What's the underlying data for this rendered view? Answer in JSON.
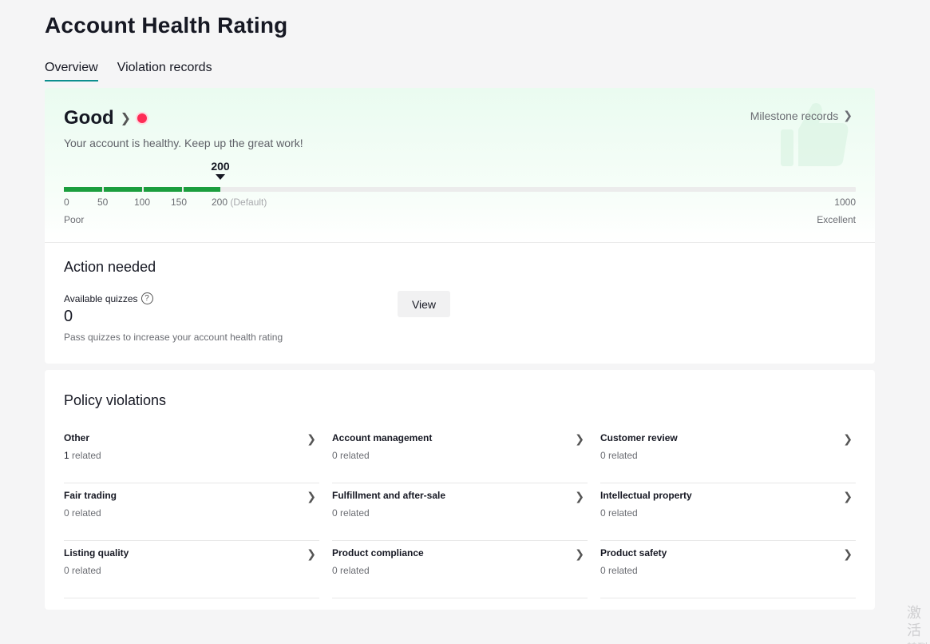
{
  "page": {
    "title": "Account Health Rating"
  },
  "tabs": [
    {
      "label": "Overview",
      "active": true
    },
    {
      "label": "Violation records",
      "active": false
    }
  ],
  "health": {
    "rating": "Good",
    "description": "Your account is healthy. Keep up the great work!",
    "milestone_label": "Milestone records",
    "current_score": "200",
    "score_value": 200,
    "score_max": 1000,
    "ticks": [
      "0",
      "50",
      "100",
      "150",
      "200"
    ],
    "default_label": "(Default)",
    "max_label": "1000",
    "min_text": "Poor",
    "max_text": "Excellent",
    "bar_color": "#1b9e3e",
    "dot_color": "#fe2c55"
  },
  "action": {
    "title": "Action needed",
    "quiz_label": "Available quizzes",
    "quiz_count": "0",
    "quiz_desc": "Pass quizzes to increase your account health rating",
    "view_label": "View"
  },
  "policy": {
    "title": "Policy violations",
    "related_suffix": "related",
    "items": [
      {
        "name": "Other",
        "count": "1"
      },
      {
        "name": "Account management",
        "count": "0"
      },
      {
        "name": "Customer review",
        "count": "0"
      },
      {
        "name": "Fair trading",
        "count": "0"
      },
      {
        "name": "Fulfillment and after-sale",
        "count": "0"
      },
      {
        "name": "Intellectual property",
        "count": "0"
      },
      {
        "name": "Listing quality",
        "count": "0"
      },
      {
        "name": "Product compliance",
        "count": "0"
      },
      {
        "name": "Product safety",
        "count": "0"
      }
    ]
  },
  "watermark": {
    "line1": "激活",
    "line2": "转到"
  }
}
